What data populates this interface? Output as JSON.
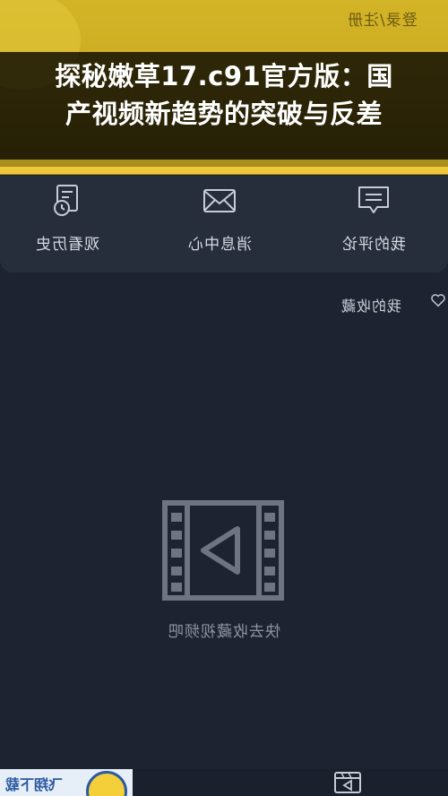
{
  "header": {
    "login_link": "登录/注册",
    "title_line1": "探秘嫩草17.c91官方版：国",
    "title_line2": "产视频新趋势的突破与反差"
  },
  "quick_actions": [
    {
      "label": "观看历史",
      "icon": "history-icon"
    },
    {
      "label": "消息中心",
      "icon": "mail-icon"
    },
    {
      "label": "我的评论",
      "icon": "comment-icon"
    }
  ],
  "favorites": {
    "label": "我的收藏",
    "icon": "heart-icon",
    "empty_text": "快去收藏视频吧",
    "empty_icon": "video-play-icon"
  },
  "bottom": {
    "banner_text": "飞翔下载",
    "tab_icon": "video-tab-icon"
  },
  "colors": {
    "header_yellow": "#c8a820",
    "accent_yellow": "#f0c63a",
    "background": "#1d2330",
    "card": "#262d3b"
  }
}
